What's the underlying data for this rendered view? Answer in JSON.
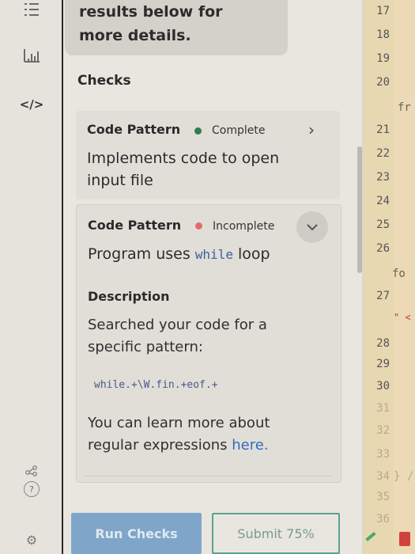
{
  "header_message": {
    "line1": "results below for",
    "line2": "more details."
  },
  "checks": {
    "heading": "Checks",
    "items": [
      {
        "label": "Code Pattern",
        "status": "Complete",
        "status_color": "#2f7d4a",
        "title_line1": "Implements code to open",
        "title_line2": "input file"
      },
      {
        "label": "Code Pattern",
        "status": "Incomplete",
        "status_color": "#e46a6a",
        "title_prefix": "Program uses ",
        "title_code": "while",
        "title_suffix": " loop",
        "description_heading": "Description",
        "description_line1": "Searched your code for a",
        "description_line2": "specific pattern:",
        "regex": "while.+\\W.fin.+eof.+",
        "learn_line1": "You can learn more about",
        "learn_line2_prefix": "regular expressions ",
        "learn_link": "here."
      }
    ]
  },
  "buttons": {
    "run": "Run Checks",
    "submit": "Submit 75%"
  },
  "editor": {
    "line_numbers": [
      "17",
      "18",
      "19",
      "20",
      "21",
      "22",
      "23",
      "24",
      "25",
      "26",
      "27",
      "28",
      "29",
      "30",
      "31",
      "32",
      "33",
      "34",
      "35",
      "36"
    ],
    "fragment_fr": "fr",
    "fragment_fo": "fo",
    "fragment_quote": "\" <",
    "fragment_close": "} /"
  },
  "icons": {
    "list": "list-icon",
    "chart": "chart-icon",
    "code": "code-icon",
    "share": "share-icon",
    "help": "help-icon",
    "settings": "gear-icon",
    "chevron_right": "chevron-right-icon",
    "chevron_down": "chevron-down-icon"
  }
}
